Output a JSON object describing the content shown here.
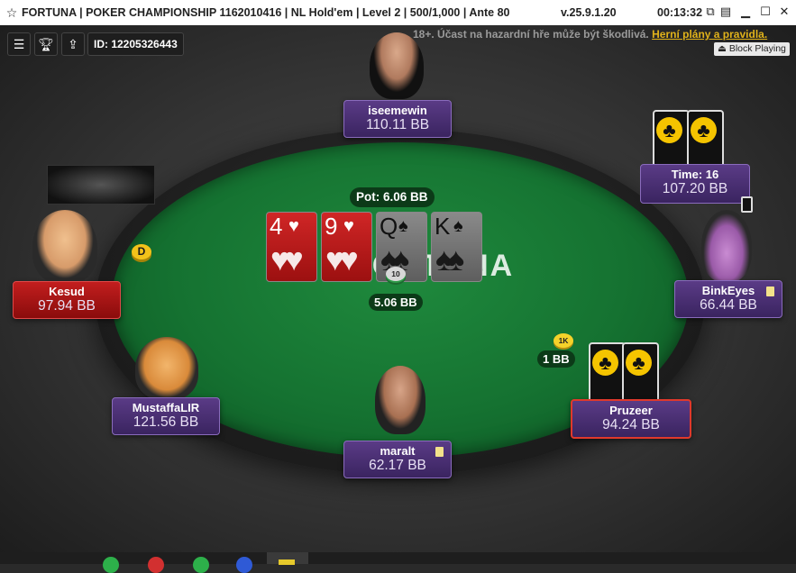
{
  "window": {
    "title": "FORTUNA | POKER CHAMPIONSHIP 1162010416 | NL Hold'em | Level 2 | 500/1,000 | Ante 80",
    "version": "v.25.9.1.20",
    "clock": "00:13:32"
  },
  "toolbar": {
    "table_id": "ID: 12205326443"
  },
  "notice": {
    "text": "18+. Účast na hazardní hře může být škodlivá.",
    "link": "Herní plány a pravidla."
  },
  "block_button": "Block Playing",
  "table": {
    "logo": "FORTUNA",
    "pot": "Pot: 6.06 BB",
    "center_bet": "5.06 BB",
    "center_chip": "10",
    "dealer": "D",
    "board": [
      {
        "rank": "4",
        "suit": "♥",
        "color": "red"
      },
      {
        "rank": "9",
        "suit": "♥",
        "color": "red"
      },
      {
        "rank": "Q",
        "suit": "♠",
        "color": "grey"
      },
      {
        "rank": "K",
        "suit": "♠",
        "color": "grey"
      }
    ]
  },
  "players": {
    "top": {
      "name": "iseemewin",
      "stack": "110.11 BB"
    },
    "left": {
      "name": "Kesud",
      "stack": "97.94 BB"
    },
    "bottom_left": {
      "name": "MustaffaLIR",
      "stack": "121.56 BB"
    },
    "bottom": {
      "name": "maralt",
      "stack": "62.17 BB"
    },
    "bottom_right": {
      "name": "Pruzeer",
      "stack": "94.24 BB",
      "bet": "1 BB",
      "bet_chip": "1K"
    },
    "right": {
      "name": "BinkEyes",
      "stack": "66.44 BB"
    },
    "top_right": {
      "timer": "Time: 16",
      "stack": "107.20 BB"
    }
  },
  "colors": {
    "felt": "#157231",
    "plate_purple": "#4a2f73",
    "plate_red": "#b01818",
    "accent_yellow": "#f5c400"
  }
}
